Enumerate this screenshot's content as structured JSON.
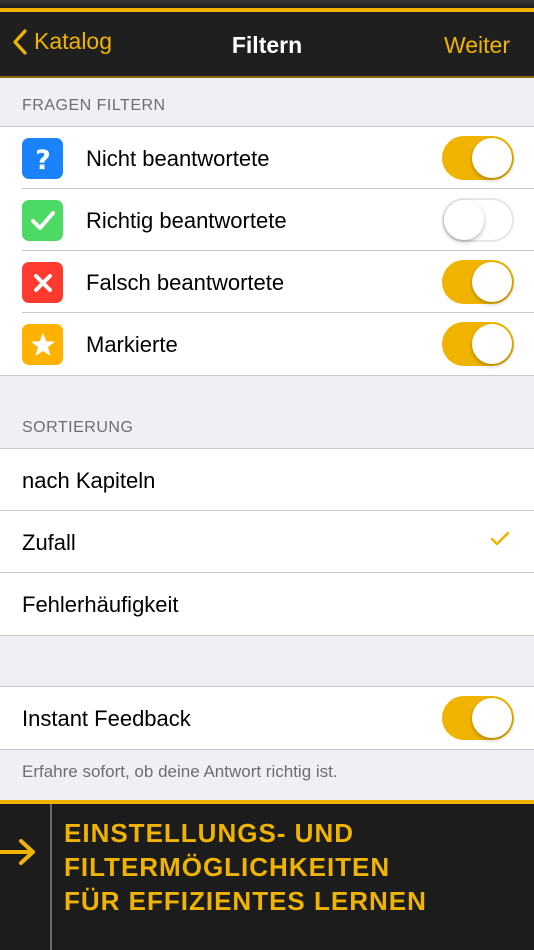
{
  "nav": {
    "back_label": "Katalog",
    "title": "Filtern",
    "next_label": "Weiter"
  },
  "filter": {
    "header": "FRAGEN FILTERN",
    "items": [
      {
        "label": "Nicht beantwortete",
        "icon": "question-mark-icon",
        "icon_color": "#1a82fb",
        "on": true
      },
      {
        "label": "Richtig beantwortete",
        "icon": "checkmark-icon",
        "icon_color": "#4cd964",
        "on": false
      },
      {
        "label": "Falsch beantwortete",
        "icon": "x-mark-icon",
        "icon_color": "#ff3b30",
        "on": true
      },
      {
        "label": "Markierte",
        "icon": "star-icon",
        "icon_color": "#ffb300",
        "on": true
      }
    ]
  },
  "sort": {
    "header": "SORTIERUNG",
    "options": [
      "nach Kapiteln",
      "Zufall",
      "Fehlerhäufigkeit"
    ],
    "selected": "Zufall"
  },
  "feedback": {
    "label": "Instant Feedback",
    "on": true,
    "description": "Erfahre sofort, ob deine Antwort richtig ist."
  },
  "banner": {
    "line1": "EINSTELLUNGS- UND",
    "line2": "FILTERMÖGLICHKEITEN",
    "line3": "FÜR EFFIZIENTES LERNEN"
  },
  "colors": {
    "accent": "#f0b400",
    "navbar": "#1f1f1f",
    "background": "#efeff4"
  }
}
